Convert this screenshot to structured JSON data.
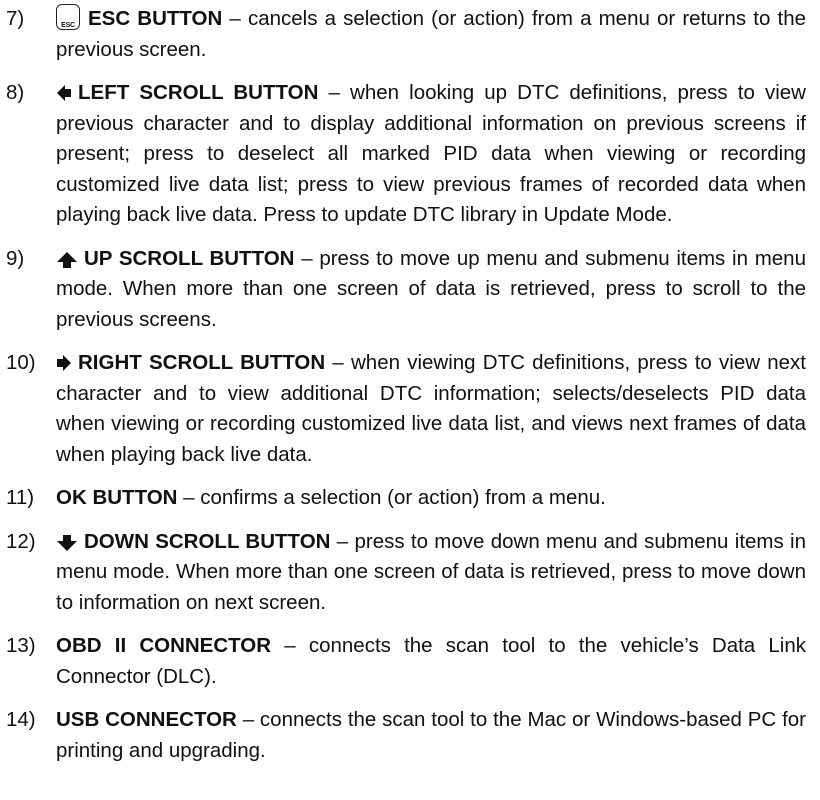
{
  "items": [
    {
      "number": "7)",
      "icon": "esc-button-icon",
      "icon_text": "ESC",
      "term": "ESC BUTTON",
      "desc": " – cancels a selection (or action) from a menu or returns to the previous screen."
    },
    {
      "number": "8)",
      "icon": "left-arrow-icon",
      "term": "LEFT SCROLL BUTTON",
      "desc": " – when looking up DTC definitions, press to view previous character and to display additional information on previous screens if present; press to deselect all marked PID data when viewing or recording customized live data list; press to view previous frames of recorded data when playing back live data. Press to update DTC library in Update Mode."
    },
    {
      "number": "9)",
      "icon": "up-arrow-icon",
      "term": "UP SCROLL BUTTON",
      "desc": " – press to move up menu and submenu items in menu mode. When more than one screen of data is retrieved, press to scroll to the previous screens."
    },
    {
      "number": "10)",
      "icon": "right-arrow-icon",
      "term": "RIGHT SCROLL BUTTON",
      "desc": " – when viewing DTC definitions, press to view next character and to view additional DTC information; selects/deselects PID data when viewing or recording customized live data list, and views next frames of data when playing back live data."
    },
    {
      "number": "11)",
      "term": "OK BUTTON",
      "desc": " – confirms a selection (or action) from a menu."
    },
    {
      "number": "12)",
      "icon": "down-arrow-icon",
      "term": "DOWN SCROLL BUTTON",
      "desc": " – press to move down menu and submenu items in menu mode. When more than one screen of data is retrieved, press to move down to information on next screen."
    },
    {
      "number": "13)",
      "term": "OBD II CONNECTOR",
      "desc": " – connects the scan tool to the vehicle’s Data Link Connector (DLC)."
    },
    {
      "number": "14)",
      "term": "USB CONNECTOR",
      "desc": " – connects the scan tool to the Mac or Windows-based PC for printing and upgrading."
    }
  ]
}
